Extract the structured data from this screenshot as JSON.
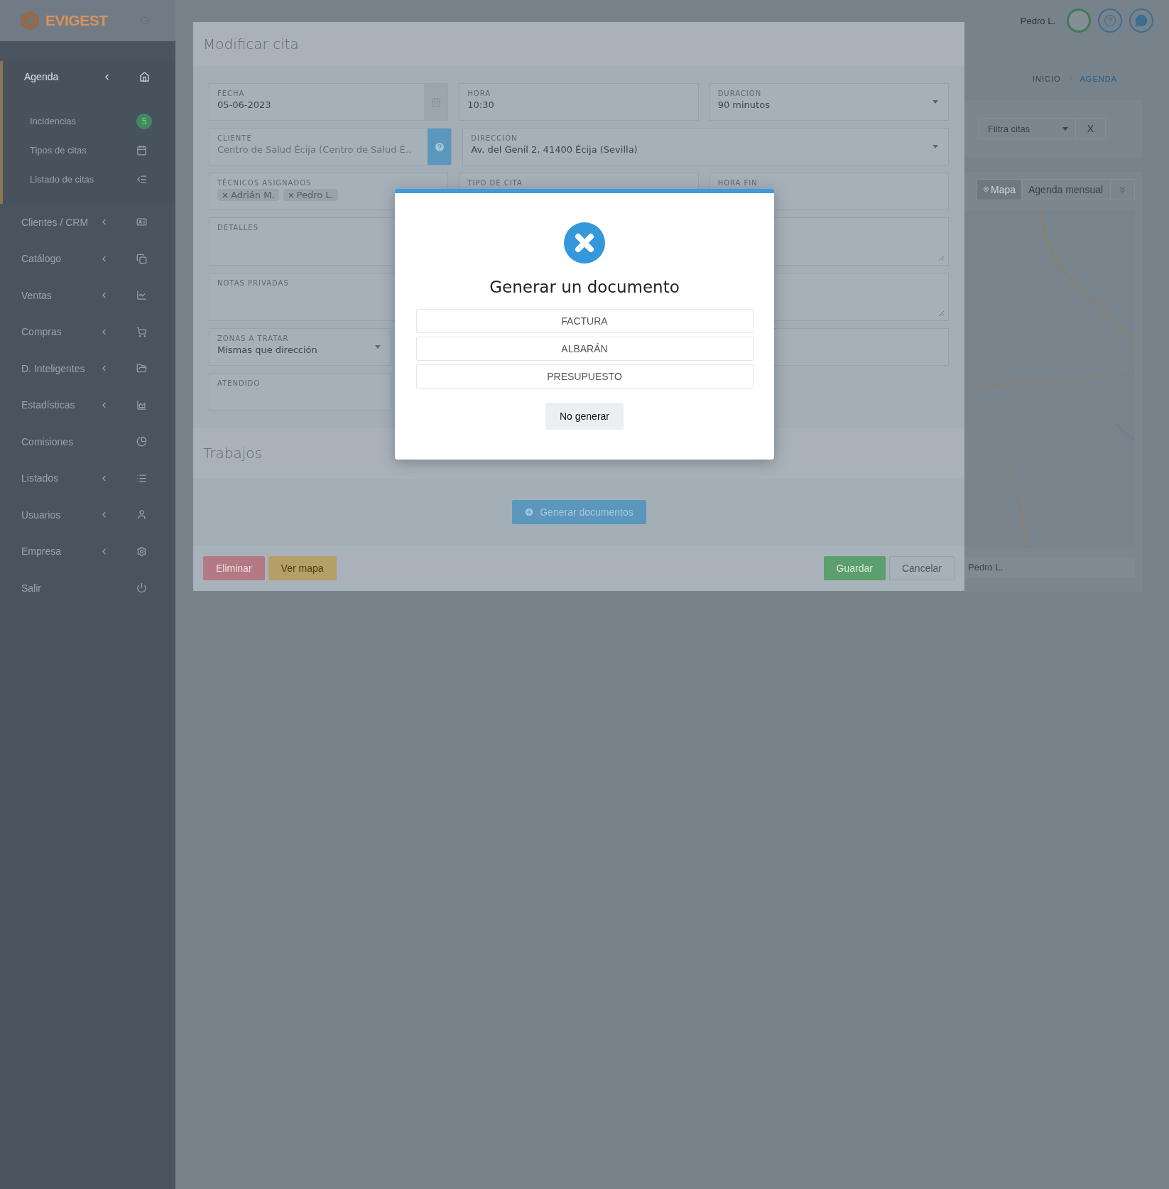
{
  "logo": "EVIGEST",
  "user": "Pedro L.",
  "sidebar": [
    {
      "label": "Agenda",
      "submenu": true,
      "selected": true,
      "children": [
        {
          "label": "Incidencias",
          "badge": "5"
        },
        {
          "label": "Tipos de citas"
        },
        {
          "label": "Listado de citas"
        }
      ]
    },
    {
      "label": "Clientes / CRM",
      "submenu": true,
      "selected": false
    },
    {
      "label": "Catálogo",
      "submenu": true,
      "selected": false
    },
    {
      "label": "Ventas",
      "submenu": true,
      "selected": false
    },
    {
      "label": "Compras",
      "submenu": true,
      "selected": false
    },
    {
      "label": "D. Inteligentes",
      "submenu": true,
      "selected": false
    },
    {
      "label": "Estadísticas",
      "submenu": true,
      "selected": false
    },
    {
      "label": "Comisiones",
      "submenu": false,
      "selected": false
    },
    {
      "label": "Listados",
      "submenu": true,
      "selected": false
    },
    {
      "label": "Usuarios",
      "submenu": true,
      "selected": false
    },
    {
      "label": "Empresa",
      "submenu": true,
      "selected": false
    },
    {
      "label": "Salir",
      "submenu": false,
      "selected": false
    }
  ],
  "breadcrumb": [
    {
      "label": "INICIO",
      "selected": false
    },
    {
      "label": "AGENDA",
      "selected": true
    }
  ],
  "filter": {
    "placeholder": "Filtra citas",
    "clear": "X"
  },
  "views": [
    {
      "label": "Mapa",
      "selected": true
    },
    {
      "label": "Agenda mensual",
      "selected": false
    }
  ],
  "list_row": "Pedro L.",
  "modal": {
    "title": "Modificar cita",
    "rows": [
      [
        {
          "kind": "date",
          "label": "FECHA",
          "value": "05-06-2023"
        },
        {
          "kind": "text",
          "label": "HORA",
          "value": "10:30"
        },
        {
          "kind": "select",
          "label": "DURACIÓN",
          "value": "90 minutos"
        }
      ],
      [
        {
          "kind": "client",
          "label": "CLIENTE",
          "placeholder": "Centro de Salud Écija (Centro de Salud É.."
        },
        {
          "kind": "select",
          "label": "DIRECCIÓN",
          "value": "Av. del Genil 2, 41400 Écija (Sevilla)"
        }
      ],
      [
        {
          "kind": "tags",
          "label": "TÉCNICOS ASIGNADOS",
          "tags": [
            "Adrián M.",
            "Pedro L."
          ]
        },
        {
          "kind": "text",
          "label": "TIPO DE CITA"
        },
        {
          "kind": "text",
          "label": "HORA FIN"
        }
      ],
      [
        {
          "kind": "textarea",
          "label": "DETALLES"
        },
        {
          "kind": "textarea"
        }
      ],
      [
        {
          "kind": "textarea",
          "label": "NOTAS PRIVADAS"
        },
        {
          "kind": "textarea"
        }
      ],
      [
        {
          "kind": "select",
          "label": "ZONAS A TRATAR",
          "value": "Mismas que dirección"
        },
        {
          "kind": "text"
        }
      ],
      [
        {
          "kind": "text",
          "label": "ATENDIDO"
        }
      ]
    ],
    "section": "Trabajos",
    "generate": "Generar documentos",
    "actions_left": [
      "Eliminar",
      "Ver mapa"
    ],
    "actions_right": [
      "Guardar",
      "Cancelar"
    ]
  },
  "dialog": {
    "title": "Generar un documento",
    "options": [
      "FACTURA",
      "ALBARÁN",
      "PRESUPUESTO"
    ],
    "cancel": "No generar"
  }
}
